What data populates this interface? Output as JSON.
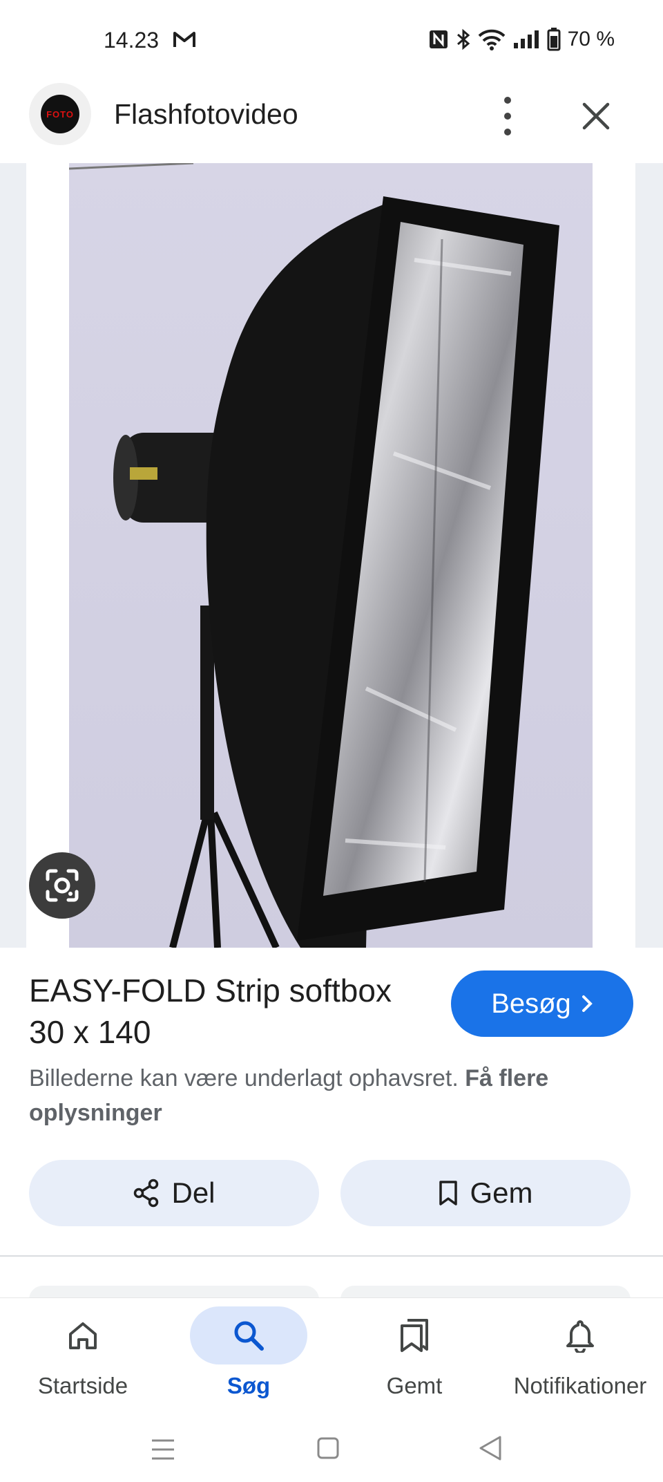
{
  "status_bar": {
    "time": "14.23",
    "battery": "70 %"
  },
  "header": {
    "site_name": "Flashfotovideo",
    "avatar_text": "FOTO"
  },
  "product": {
    "title": "EASY-FOLD Strip softbox 30 x 140",
    "visit_label": "Besøg",
    "copyright_text": "Billederne kan være underlagt ophavsret.",
    "copyright_link": "Få flere oplysninger"
  },
  "actions": {
    "share_label": "Del",
    "save_label": "Gem"
  },
  "bottom_nav": {
    "items": [
      {
        "label": "Startside",
        "icon": "home-icon"
      },
      {
        "label": "Søg",
        "icon": "search-icon",
        "active": true
      },
      {
        "label": "Gemt",
        "icon": "bookmarks-icon"
      },
      {
        "label": "Notifikationer",
        "icon": "bell-icon"
      }
    ]
  },
  "colors": {
    "accent": "#1a73e8",
    "chip_bg": "#e8eef9",
    "active_nav": "#0b57d0"
  }
}
